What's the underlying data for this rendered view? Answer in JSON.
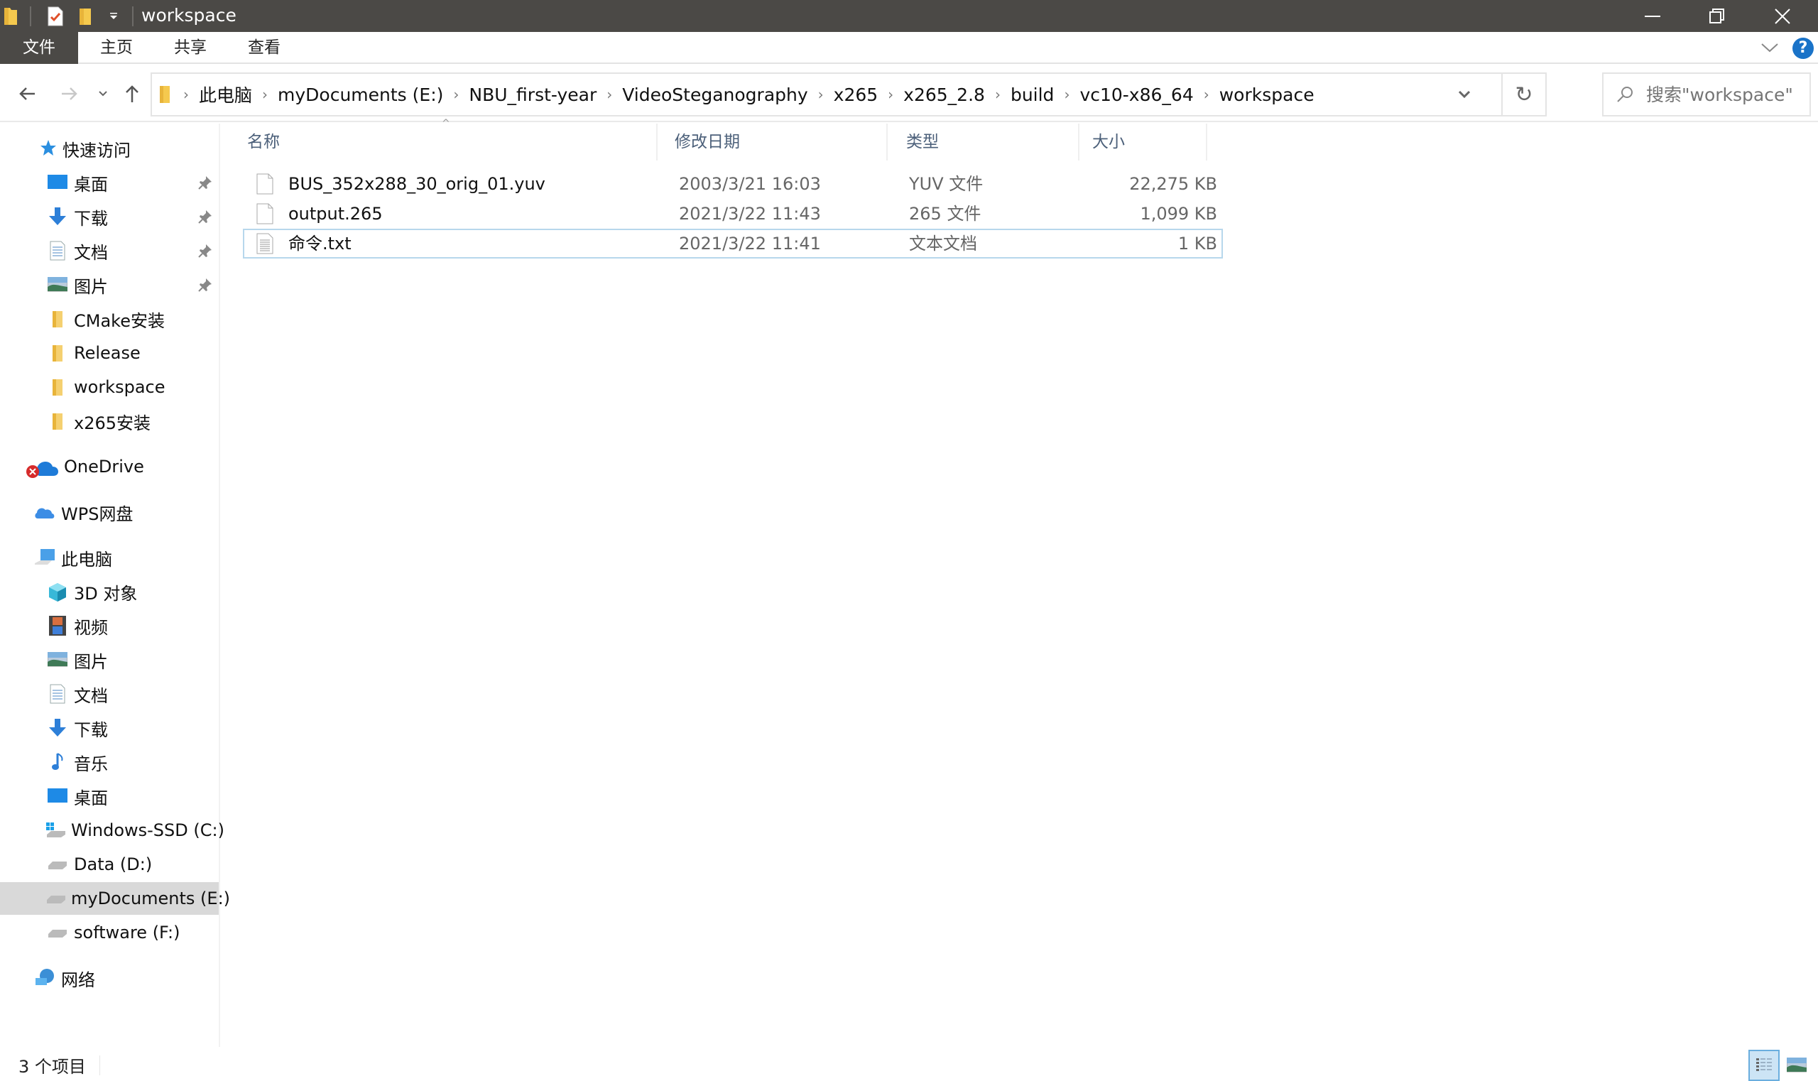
{
  "window": {
    "title": "workspace",
    "controls": {
      "minimize": "minimize",
      "restore": "restore",
      "close": "close"
    }
  },
  "ribbon": {
    "tabs": [
      {
        "label": "文件",
        "active": true
      },
      {
        "label": "主页"
      },
      {
        "label": "共享"
      },
      {
        "label": "查看"
      }
    ]
  },
  "address": {
    "breadcrumbs": [
      "此电脑",
      "myDocuments (E:)",
      "NBU_first-year",
      "VideoSteganography",
      "x265",
      "x265_2.8",
      "build",
      "vc10-x86_64",
      "workspace"
    ],
    "search_placeholder": "搜索\"workspace\""
  },
  "sidebar": {
    "quick_access": {
      "label": "快速访问",
      "icon": "star-icon"
    },
    "quick_items": [
      {
        "label": "桌面",
        "icon": "desktop-icon",
        "pinned": true
      },
      {
        "label": "下载",
        "icon": "download-icon",
        "pinned": true
      },
      {
        "label": "文档",
        "icon": "document-icon",
        "pinned": true
      },
      {
        "label": "图片",
        "icon": "pictures-icon",
        "pinned": true
      },
      {
        "label": "CMake安装",
        "icon": "folder-icon"
      },
      {
        "label": "Release",
        "icon": "folder-icon"
      },
      {
        "label": "workspace",
        "icon": "folder-icon"
      },
      {
        "label": "x265安装",
        "icon": "folder-icon"
      }
    ],
    "onedrive": {
      "label": "OneDrive",
      "status": "error"
    },
    "wps": {
      "label": "WPS网盘"
    },
    "this_pc": {
      "label": "此电脑"
    },
    "pc_items": [
      {
        "label": "3D 对象",
        "icon": "3d-objects-icon"
      },
      {
        "label": "视频",
        "icon": "video-icon"
      },
      {
        "label": "图片",
        "icon": "pictures-icon"
      },
      {
        "label": "文档",
        "icon": "document-icon"
      },
      {
        "label": "下载",
        "icon": "download-icon"
      },
      {
        "label": "音乐",
        "icon": "music-icon"
      },
      {
        "label": "桌面",
        "icon": "desktop-icon"
      },
      {
        "label": "Windows-SSD (C:)",
        "icon": "windows-drive-icon"
      },
      {
        "label": "Data (D:)",
        "icon": "drive-icon"
      },
      {
        "label": "myDocuments (E:)",
        "icon": "drive-icon",
        "selected": true
      },
      {
        "label": "software (F:)",
        "icon": "drive-icon"
      }
    ],
    "network": {
      "label": "网络"
    }
  },
  "files": {
    "columns": [
      "名称",
      "修改日期",
      "类型",
      "大小"
    ],
    "rows": [
      {
        "name": "BUS_352x288_30_orig_01.yuv",
        "date": "2003/3/21 16:03",
        "type": "YUV 文件",
        "size": "22,275 KB",
        "icon": "file-icon"
      },
      {
        "name": "output.265",
        "date": "2021/3/22 11:43",
        "type": "265 文件",
        "size": "1,099 KB",
        "icon": "file-icon"
      },
      {
        "name": "命令.txt",
        "date": "2021/3/22 11:41",
        "type": "文本文档",
        "size": "1 KB",
        "icon": "text-file-icon",
        "focused": true
      }
    ]
  },
  "status": {
    "item_count": "3 个项目"
  },
  "colors": {
    "titlebar": "#4b4946",
    "header_text": "#4c607a",
    "selected_nav": "#d9d9d9",
    "focus_border": "#b7d7ec",
    "help": "#1a73c8"
  }
}
